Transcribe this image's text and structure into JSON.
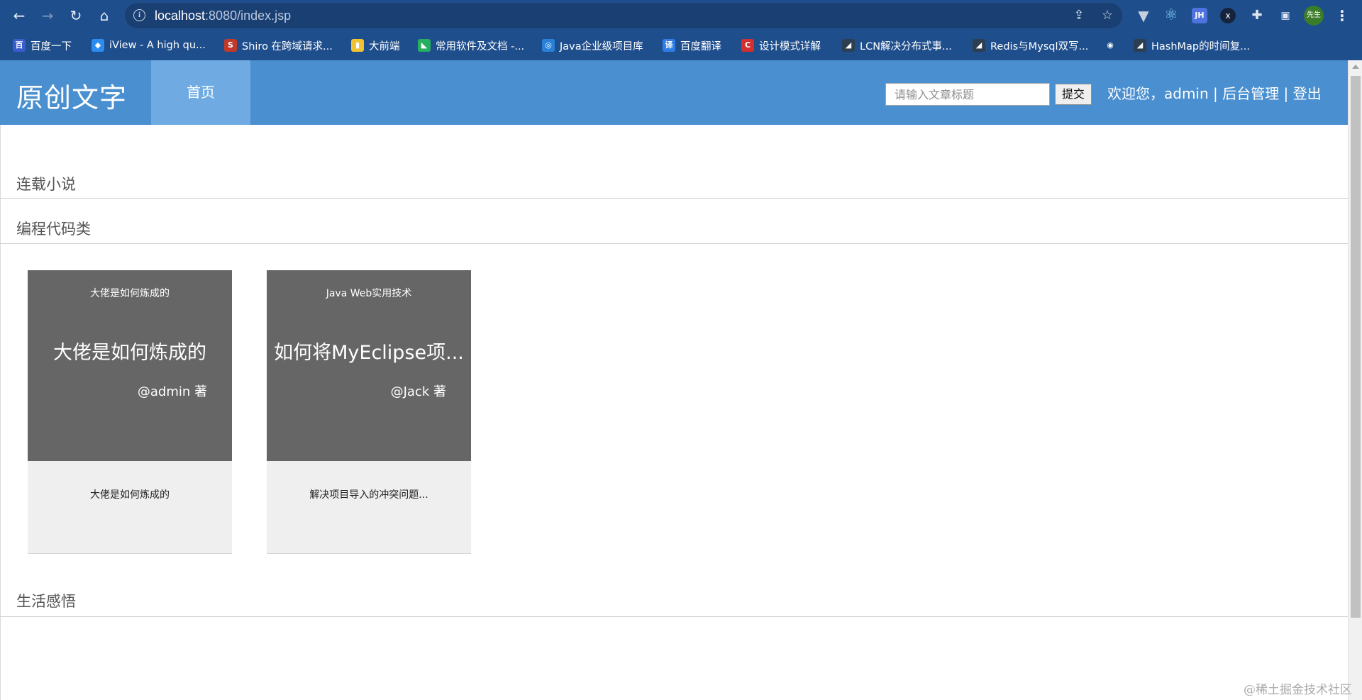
{
  "browser": {
    "url_host": "localhost",
    "url_rest": ":8080/index.jsp",
    "profile_label": "先生",
    "bookmarks": [
      {
        "label": "百度一下",
        "color": "#3a5ccc",
        "glyph": "百"
      },
      {
        "label": "iView - A high qu...",
        "color": "#2d8cf0",
        "glyph": "◆"
      },
      {
        "label": "Shiro 在跨域请求...",
        "color": "#c0392b",
        "glyph": "S"
      },
      {
        "label": "大前端",
        "color": "#f1c232",
        "glyph": "▮"
      },
      {
        "label": "常用软件及文档 -...",
        "color": "#27ae60",
        "glyph": "◣"
      },
      {
        "label": "Java企业级项目库",
        "color": "#2980d9",
        "glyph": "◎"
      },
      {
        "label": "百度翻译",
        "color": "#2e7ee6",
        "glyph": "译"
      },
      {
        "label": "设计模式详解",
        "color": "#d32f2f",
        "glyph": "C"
      },
      {
        "label": "LCN解决分布式事...",
        "color": "#2c3e50",
        "glyph": "◢"
      },
      {
        "label": "Redis与Mysql双写...",
        "color": "#2c3e50",
        "glyph": "◢"
      },
      {
        "label": "",
        "color": "#1f4e8c",
        "glyph": "◉"
      },
      {
        "label": "HashMap的时间复...",
        "color": "#2c3e50",
        "glyph": "◢"
      }
    ]
  },
  "header": {
    "logo": "原创文字",
    "nav_home": "首页",
    "search_placeholder": "请输入文章标题",
    "submit_label": "提交",
    "welcome": "欢迎您，",
    "username": "admin",
    "sep1": " | ",
    "admin_link": "后台管理",
    "sep2": " | ",
    "logout_link": "登出"
  },
  "sections": {
    "serial": "连载小说",
    "coding": "编程代码类",
    "life": "生活感悟"
  },
  "cards": [
    {
      "category": "大佬是如何炼成的",
      "headline": "大佬是如何炼成的",
      "author": "@admin 著",
      "summary": "大佬是如何炼成的"
    },
    {
      "category": "Java Web实用技术",
      "headline": "如何将MyEclipse项...",
      "author": "@Jack 著",
      "summary": "解决项目导入的冲突问题..."
    }
  ],
  "watermark": "@稀土掘金技术社区"
}
